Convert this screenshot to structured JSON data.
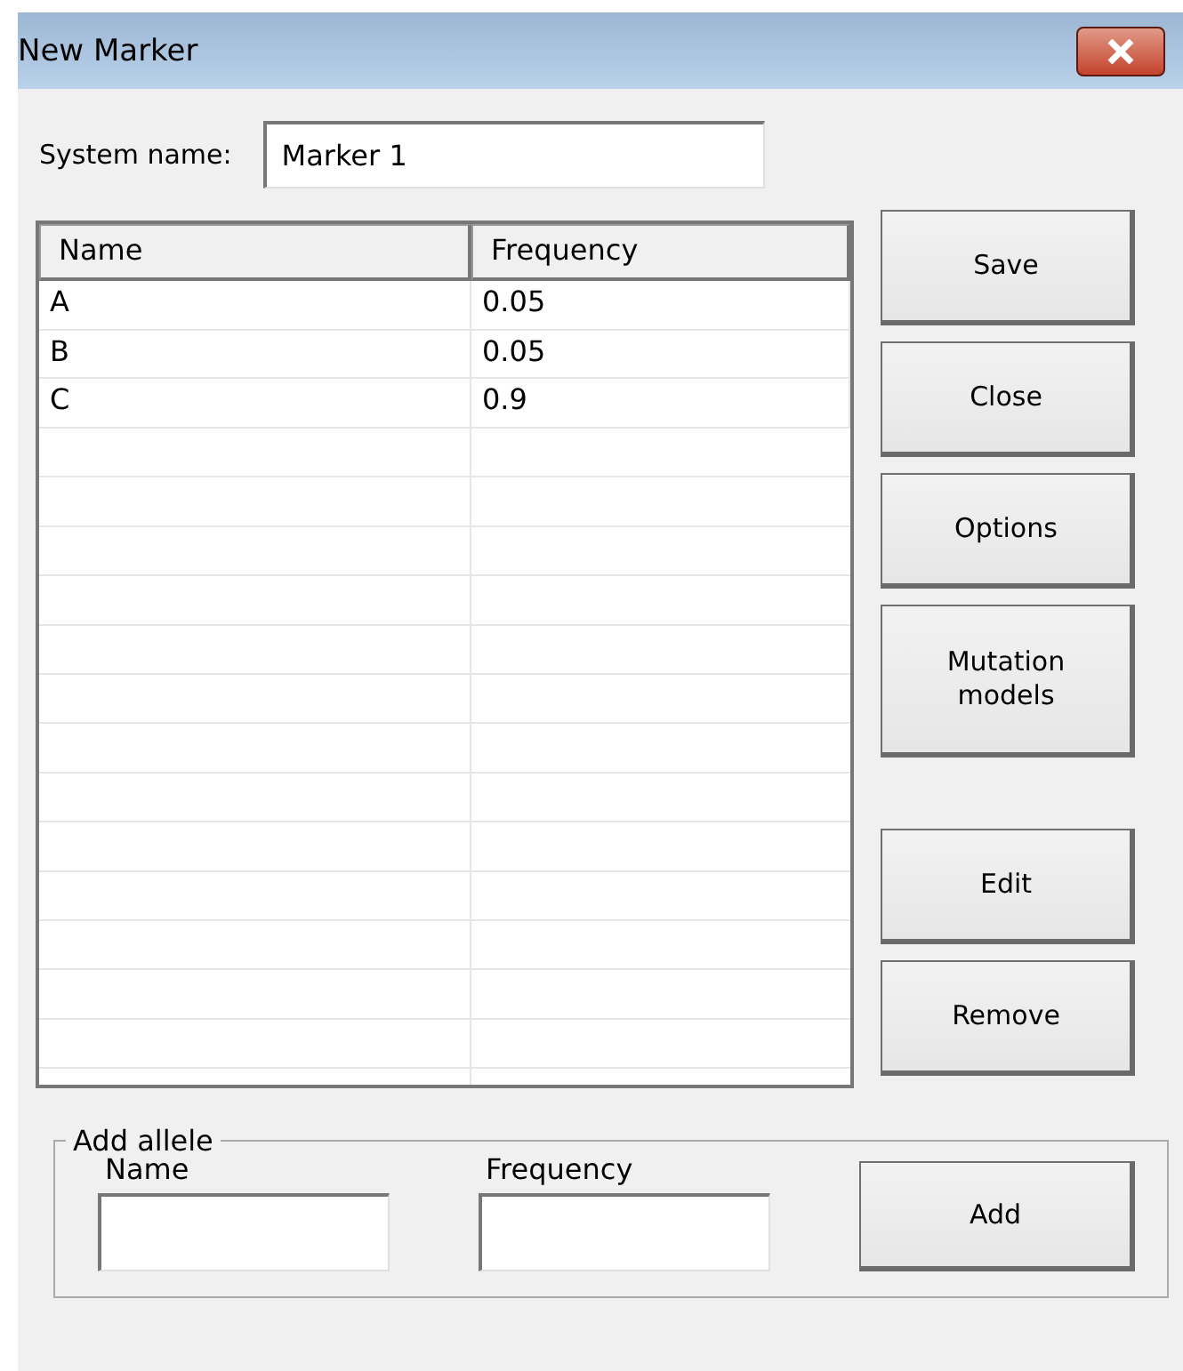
{
  "window": {
    "title": "New Marker"
  },
  "system_name": {
    "label": "System name:",
    "value": "Marker 1"
  },
  "table": {
    "columns": [
      "Name",
      "Frequency"
    ],
    "rows": [
      [
        "A",
        "0.05"
      ],
      [
        "B",
        "0.05"
      ],
      [
        "C",
        "0.9"
      ]
    ]
  },
  "side_buttons": [
    {
      "label": "Save",
      "kind": "normal"
    },
    {
      "label": "Close",
      "kind": "normal"
    },
    {
      "label": "Options",
      "kind": "normal"
    },
    {
      "label": "Mutation models",
      "kind": "tall"
    },
    {
      "label": "Edit",
      "kind": "spaced"
    },
    {
      "label": "Remove",
      "kind": "normal"
    }
  ],
  "add_allele": {
    "title": "Add allele",
    "name_label": "Name",
    "frequency_label": "Frequency",
    "button": "Add"
  }
}
